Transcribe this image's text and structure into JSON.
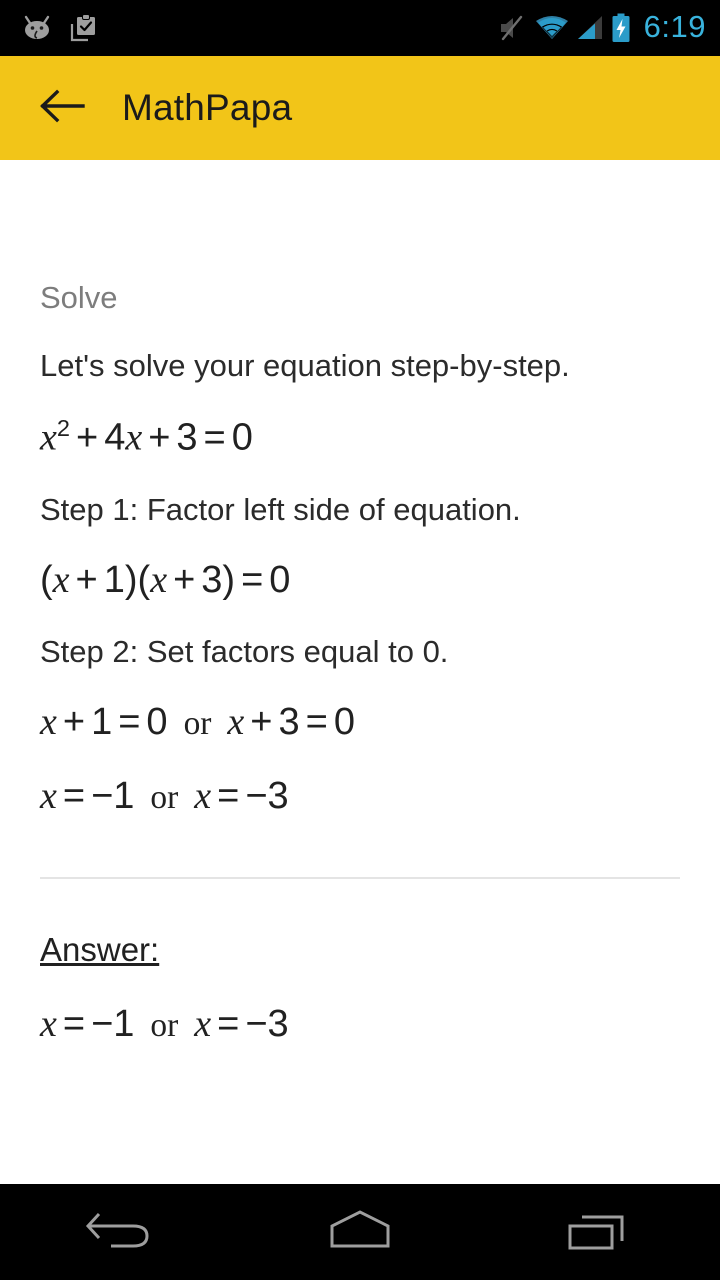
{
  "status_bar": {
    "icons_left": [
      "android-face-icon",
      "clipboard-check-icon"
    ],
    "icons_right": [
      "volume-mute-icon",
      "wifi-icon",
      "cellular-signal-icon",
      "battery-charging-icon"
    ],
    "time": "6:19",
    "time_color": "#39b3dd",
    "background": "#000000"
  },
  "app_bar": {
    "back_icon": "back-arrow-icon",
    "title": "MathPapa",
    "background": "#f2c518",
    "title_color": "#1b1b1b"
  },
  "content": {
    "section_label": "Solve",
    "intro": "Let's solve your equation step-by-step.",
    "equation": {
      "base": "x",
      "exponent": "2",
      "plus1": "+",
      "term2_coeff": "4",
      "term2_var": "x",
      "plus2": "+",
      "term3": "3",
      "equals": "=",
      "rhs": "0"
    },
    "step1_label": "Step 1: Factor left side of equation.",
    "factored": {
      "open1": "(",
      "var1": "x",
      "op1": "+",
      "num1": "1",
      "close1": ")",
      "open2": "(",
      "var2": "x",
      "op2": "+",
      "num2": "3",
      "close2": ")",
      "equals": "=",
      "rhs": "0"
    },
    "step2_label": "Step 2: Set factors equal to 0.",
    "factors_zero": {
      "left_var": "x",
      "left_op": "+",
      "left_num": "1",
      "left_eq": "=",
      "left_rhs": "0",
      "conj": "or",
      "right_var": "x",
      "right_op": "+",
      "right_num": "3",
      "right_eq": "=",
      "right_rhs": "0"
    },
    "solutions": {
      "left_var": "x",
      "left_eq": "=",
      "left_val": "−1",
      "conj": "or",
      "right_var": "x",
      "right_eq": "=",
      "right_val": "−3"
    },
    "answer_label": "Answer:",
    "answer": {
      "left_var": "x",
      "left_eq": "=",
      "left_val": "−1",
      "conj": "or",
      "right_var": "x",
      "right_eq": "=",
      "right_val": "−3"
    },
    "label_color": "#7d7d7d",
    "text_color": "#2b2b2b"
  },
  "nav_bar": {
    "back_icon": "nav-back-icon",
    "home_icon": "nav-home-icon",
    "recents_icon": "nav-recents-icon",
    "background": "#000000",
    "icon_color": "#9e9e9e"
  }
}
